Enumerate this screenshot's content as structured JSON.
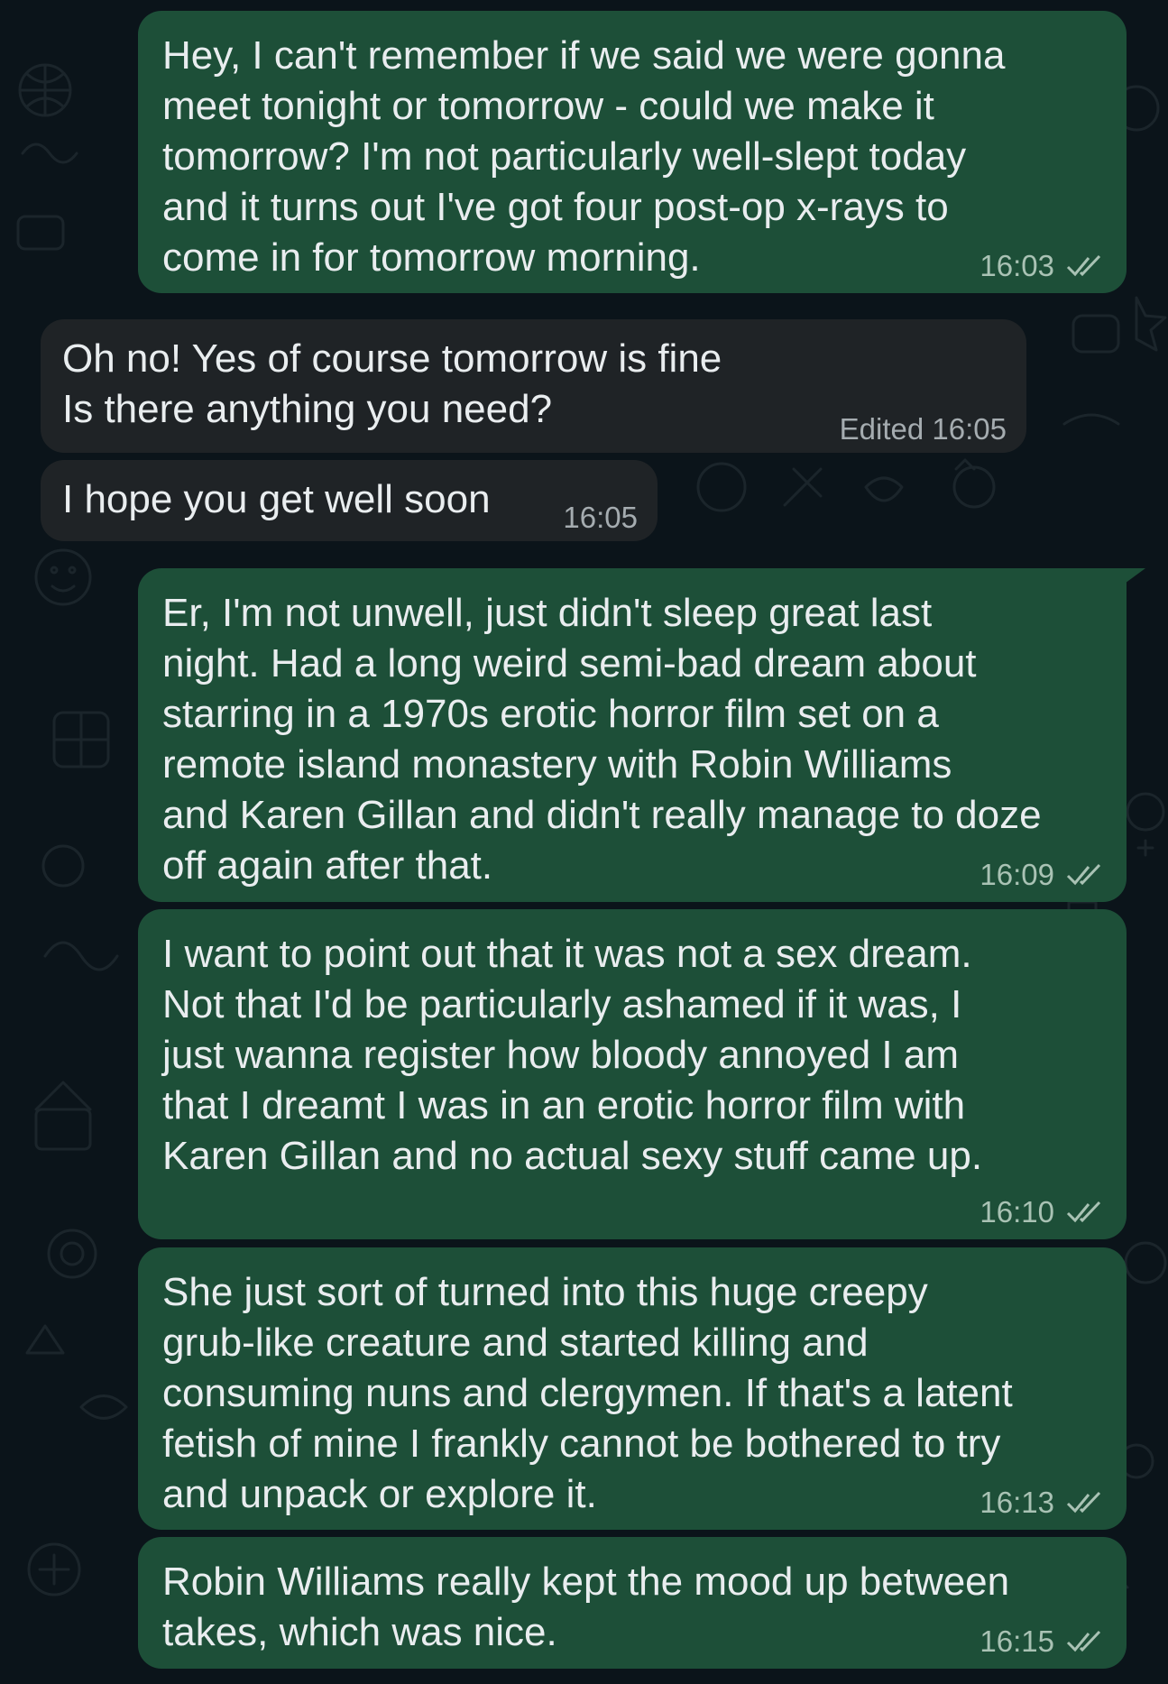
{
  "messages": [
    {
      "direction": "outgoing",
      "text": "Hey, I can't remember if we said we were gonna\nmeet tonight or tomorrow - could we make it\ntomorrow? I'm not particularly well-slept today\nand it turns out I've got four post-op x-rays to\ncome in for tomorrow morning.",
      "time": "16:03",
      "status": "read"
    },
    {
      "direction": "incoming",
      "text": "Oh no! Yes of course tomorrow is fine\nIs there anything you need?",
      "time": "Edited 16:05"
    },
    {
      "direction": "incoming",
      "text": "I hope you get well soon",
      "time": "16:05"
    },
    {
      "direction": "outgoing",
      "text": "Er, I'm not unwell, just didn't sleep great last\nnight. Had a long weird semi-bad dream about\nstarring in a 1970s erotic horror film set on a\nremote island monastery with Robin Williams\nand Karen Gillan and didn't really manage to doze\noff again after that.",
      "time": "16:09",
      "status": "read"
    },
    {
      "direction": "outgoing",
      "text": "I want to point out that it was not a sex dream.\nNot that I'd be particularly ashamed if it was, I\njust wanna register how bloody annoyed I am\nthat I dreamt I was in an erotic horror film with\nKaren Gillan and no actual sexy stuff came up.",
      "time": "16:10",
      "status": "read"
    },
    {
      "direction": "outgoing",
      "text": "She just sort of turned into this huge creepy\ngrub-like creature and started killing and\nconsuming nuns and clergymen. If that's a latent\nfetish of mine I frankly cannot be bothered to try\nand unpack or explore it.",
      "time": "16:13",
      "status": "read"
    },
    {
      "direction": "outgoing",
      "text": "Robin Williams really kept the mood up between\ntakes, which was nice.",
      "time": "16:15",
      "status": "read"
    }
  ],
  "colors": {
    "background": "#0b141a",
    "outgoing_bubble": "#1d4f38",
    "incoming_bubble": "#1f2326",
    "text": "#e9edef",
    "outgoing_meta": "#a9c2b4",
    "incoming_meta": "#a5acb0",
    "doodle": "#1a2328"
  },
  "icons": {
    "read_status": "double-check-icon"
  }
}
